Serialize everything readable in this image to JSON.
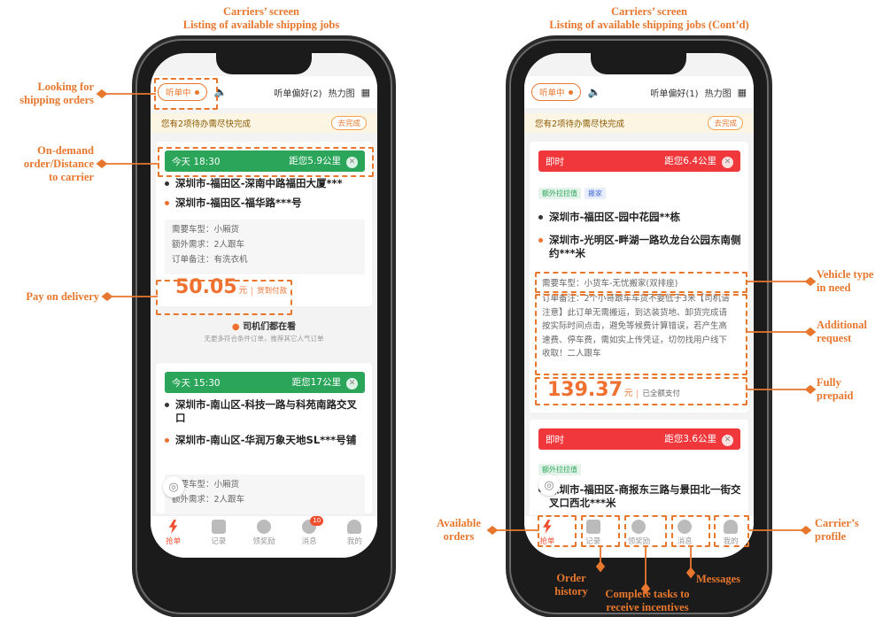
{
  "titles": {
    "left": [
      "Carriers’ screen",
      "Listing of available shipping jobs"
    ],
    "right": [
      "Carriers’ screen",
      "Listing of available shipping jobs (Cont’d)"
    ]
  },
  "annotations": {
    "looking_for": [
      "Looking for",
      "shipping orders"
    ],
    "on_demand": [
      "On-demand",
      "order/Distance",
      "to carrier"
    ],
    "pay_on_delivery": "Pay on delivery",
    "vehicle_type": [
      "Vehicle type",
      "in need"
    ],
    "additional_request": [
      "Additional",
      "request"
    ],
    "fully_prepaid": [
      "Fully",
      "prepaid"
    ],
    "available_orders": [
      "Available",
      "orders"
    ],
    "order_history": [
      "Order",
      "history"
    ],
    "complete_tasks": [
      "Complete tasks to",
      "receive incentives"
    ],
    "messages": "Messages",
    "carriers_profile": [
      "Carrier’s",
      "profile"
    ]
  },
  "left_phone": {
    "topbar": {
      "status": "听单中",
      "prefs": "听单偏好(2)",
      "heatmap": "热力图"
    },
    "notice": {
      "text": "您有2项待办需尽快完成",
      "button": "去完成"
    },
    "card1": {
      "header_time": "今天 18:30",
      "header_distance": "距您5.9公里",
      "addr_from": "深圳市-福田区-深南中路福田大厦***",
      "addr_to": "深圳市-福田区-福华路***号",
      "info": [
        "需要车型：小厢货",
        "额外需求：2人跟车",
        "订单备注：有洗衣机"
      ],
      "price": "50.05",
      "price_unit": "元",
      "pay_tag": "货到付款"
    },
    "divider": {
      "title": "司机们都在看",
      "subtitle": "无更多符合条件订单，推荐其它人气订单"
    },
    "card2": {
      "header_time": "今天 15:30",
      "header_distance": "距您17公里",
      "addr_from": "深圳市-南山区-科技一路与科苑南路交叉口",
      "addr_to": "深圳市-南山区-华润万象天地SL***号铺",
      "info": [
        "需要车型：小厢货",
        "额外需求：2人跟车"
      ]
    },
    "tabs": [
      {
        "label": "抢单",
        "active": true
      },
      {
        "label": "记录",
        "active": false
      },
      {
        "label": "领奖励",
        "active": false
      },
      {
        "label": "消息",
        "active": false,
        "badge": "10"
      },
      {
        "label": "我的",
        "active": false
      }
    ]
  },
  "right_phone": {
    "topbar": {
      "status": "听单中",
      "prefs": "听单偏好(1)",
      "heatmap": "热力图"
    },
    "notice": {
      "text": "您有2项待办需尽快完成",
      "button": "去完成"
    },
    "card1": {
      "header_time": "即时",
      "header_distance": "距您6.4公里",
      "tags": [
        "额外拉拉值",
        "搬家"
      ],
      "addr_from": "深圳市-福田区-园中花园**栋",
      "addr_to": "深圳市-光明区-畔湖一路玖龙台公园东南侧约***米",
      "vehicle": "需要车型：小货车-无忧搬家(双排座)",
      "remark": "订单备注：2个小哥跟车车货不要低于3米【司机请注意】此订单无需搬运，到达装货地、卸货完成请按实际时间点击，避免等候费计算错误，若产生高速费、停车费，需如实上传凭证，切勿找用户线下收取！二人跟车",
      "price": "139.37",
      "price_unit": "元",
      "pay_tag": "已全额支付"
    },
    "card2": {
      "header_time": "即时",
      "header_distance": "距您3.6公里",
      "tags": [
        "额外拉拉值"
      ],
      "addr_from": "深圳市-福田区-商报东三路与景田北一街交叉口西北***米"
    },
    "tabs": [
      {
        "label": "抢单",
        "active": true
      },
      {
        "label": "记录",
        "active": false
      },
      {
        "label": "领奖励",
        "active": false
      },
      {
        "label": "消息",
        "active": false
      },
      {
        "label": "我的",
        "active": false
      }
    ]
  },
  "colors": {
    "annotation": "#e8772e",
    "green_header": "#2aa55a",
    "red_header": "#f0373b",
    "price": "#f07030"
  }
}
